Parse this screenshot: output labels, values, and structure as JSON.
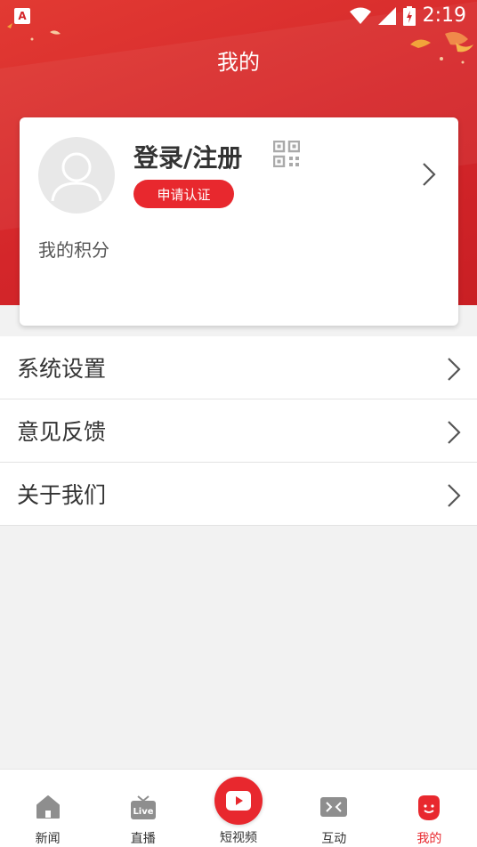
{
  "status_bar": {
    "app_badge": "A",
    "time": "2:19"
  },
  "header": {
    "title": "我的"
  },
  "profile": {
    "login_label": "登录/注册",
    "certify_button": "申请认证",
    "points_label": "我的积分"
  },
  "menu": {
    "items": [
      {
        "label": "系统设置"
      },
      {
        "label": "意见反馈"
      },
      {
        "label": "关于我们"
      }
    ]
  },
  "tab_bar": {
    "tabs": [
      {
        "label": "新闻",
        "icon": "home-icon"
      },
      {
        "label": "直播",
        "icon": "live-tv-icon"
      },
      {
        "label": "短视频",
        "icon": "play-icon"
      },
      {
        "label": "互动",
        "icon": "interact-icon"
      },
      {
        "label": "我的",
        "icon": "smiley-icon",
        "active": true
      }
    ]
  },
  "colors": {
    "brand_red": "#e8282e",
    "hero_red": "#d4262a"
  }
}
